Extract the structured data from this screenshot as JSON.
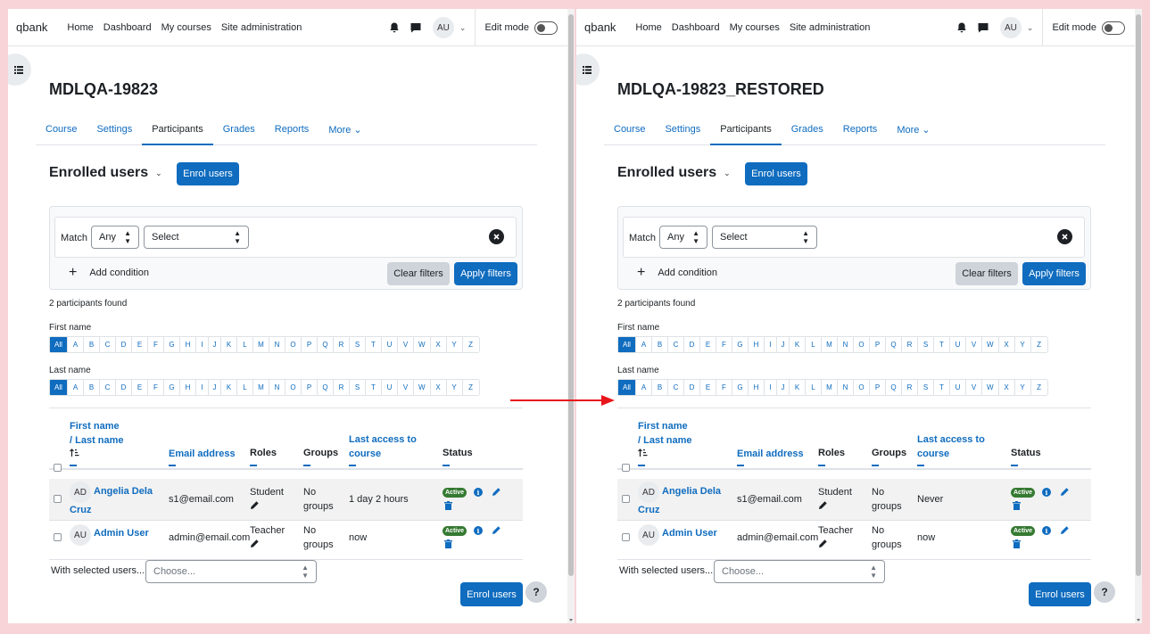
{
  "colors": {
    "background": "#f8d4d9",
    "primary": "#0f6cbf",
    "active_badge": "#357a32",
    "arrow": "#e8161b"
  },
  "panes": [
    {
      "navbar": {
        "brand": "qbank",
        "links": [
          "Home",
          "Dashboard",
          "My courses",
          "Site administration"
        ],
        "avatar": "AU",
        "edit_mode": "Edit mode"
      },
      "course_title": "MDLQA-19823",
      "tabs": [
        "Course",
        "Settings",
        "Participants",
        "Grades",
        "Reports",
        "More ⌄"
      ],
      "active_tab": "Participants",
      "enrolled_heading": "Enrolled users",
      "enrol_button": "Enrol users",
      "filter": {
        "match_label": "Match",
        "match_value": "Any",
        "select_value": "Select",
        "add_condition": "Add condition",
        "clear": "Clear filters",
        "apply": "Apply filters"
      },
      "participants_found": "2 participants found",
      "first_name_label": "First name",
      "last_name_label": "Last name",
      "alphabet": [
        "All",
        "A",
        "B",
        "C",
        "D",
        "E",
        "F",
        "G",
        "H",
        "I",
        "J",
        "K",
        "L",
        "M",
        "N",
        "O",
        "P",
        "Q",
        "R",
        "S",
        "T",
        "U",
        "V",
        "W",
        "X",
        "Y",
        "Z"
      ],
      "table": {
        "col_first": "First name",
        "col_last": "/ Last name",
        "col_email": "Email address",
        "col_roles": "Roles",
        "col_groups": "Groups",
        "col_access_1": "Last access to",
        "col_access_2": "course",
        "col_status": "Status",
        "rows": [
          {
            "initials": "AD",
            "name_1": "Angelia Dela",
            "name_2": "Cruz",
            "email": "s1@email.com",
            "role": "Student",
            "groups_1": "No",
            "groups_2": "groups",
            "access": "1 day 2 hours",
            "status": "Active"
          },
          {
            "initials": "AU",
            "name_1": "Admin User",
            "name_2": "",
            "email": "admin@email.com",
            "role": "Teacher",
            "groups_1": "No",
            "groups_2": "groups",
            "access": "now",
            "status": "Active"
          }
        ]
      },
      "with_selected": "With selected users...",
      "choose": "Choose...",
      "enrol_bottom": "Enrol users",
      "help": "?"
    },
    {
      "navbar": {
        "brand": "qbank",
        "links": [
          "Home",
          "Dashboard",
          "My courses",
          "Site administration"
        ],
        "avatar": "AU",
        "edit_mode": "Edit mode"
      },
      "course_title": "MDLQA-19823_RESTORED",
      "tabs": [
        "Course",
        "Settings",
        "Participants",
        "Grades",
        "Reports",
        "More ⌄"
      ],
      "active_tab": "Participants",
      "enrolled_heading": "Enrolled users",
      "enrol_button": "Enrol users",
      "filter": {
        "match_label": "Match",
        "match_value": "Any",
        "select_value": "Select",
        "add_condition": "Add condition",
        "clear": "Clear filters",
        "apply": "Apply filters"
      },
      "participants_found": "2 participants found",
      "first_name_label": "First name",
      "last_name_label": "Last name",
      "alphabet": [
        "All",
        "A",
        "B",
        "C",
        "D",
        "E",
        "F",
        "G",
        "H",
        "I",
        "J",
        "K",
        "L",
        "M",
        "N",
        "O",
        "P",
        "Q",
        "R",
        "S",
        "T",
        "U",
        "V",
        "W",
        "X",
        "Y",
        "Z"
      ],
      "table": {
        "col_first": "First name",
        "col_last": "/ Last name",
        "col_email": "Email address",
        "col_roles": "Roles",
        "col_groups": "Groups",
        "col_access_1": "Last access to",
        "col_access_2": "course",
        "col_status": "Status",
        "rows": [
          {
            "initials": "AD",
            "name_1": "Angelia Dela",
            "name_2": "Cruz",
            "email": "s1@email.com",
            "role": "Student",
            "groups_1": "No",
            "groups_2": "groups",
            "access": "Never",
            "status": "Active"
          },
          {
            "initials": "AU",
            "name_1": "Admin User",
            "name_2": "",
            "email": "admin@email.com",
            "role": "Teacher",
            "groups_1": "No",
            "groups_2": "groups",
            "access": "now",
            "status": "Active"
          }
        ]
      },
      "with_selected": "With selected users...",
      "choose": "Choose...",
      "enrol_bottom": "Enrol users",
      "help": "?"
    }
  ]
}
